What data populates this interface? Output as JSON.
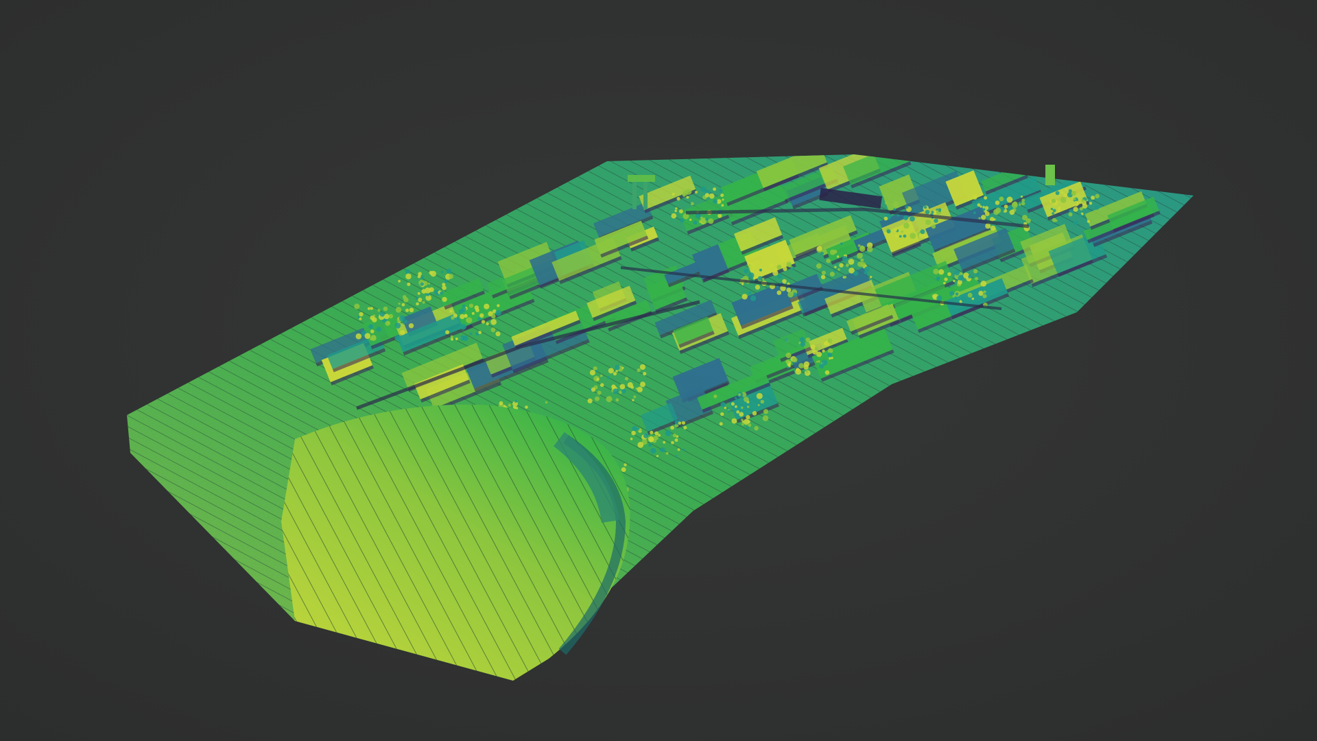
{
  "scene": {
    "subject": "point-cloud-render",
    "colormap": "viridis",
    "colors": {
      "background": "#2c2d2d",
      "background_center": "#363737",
      "deep_purple": "#3b2a5a",
      "blue": "#2f6f8e",
      "teal": "#1f9a8a",
      "green": "#35b34a",
      "lime": "#8cc63e",
      "yellow": "#c8d83a"
    }
  }
}
